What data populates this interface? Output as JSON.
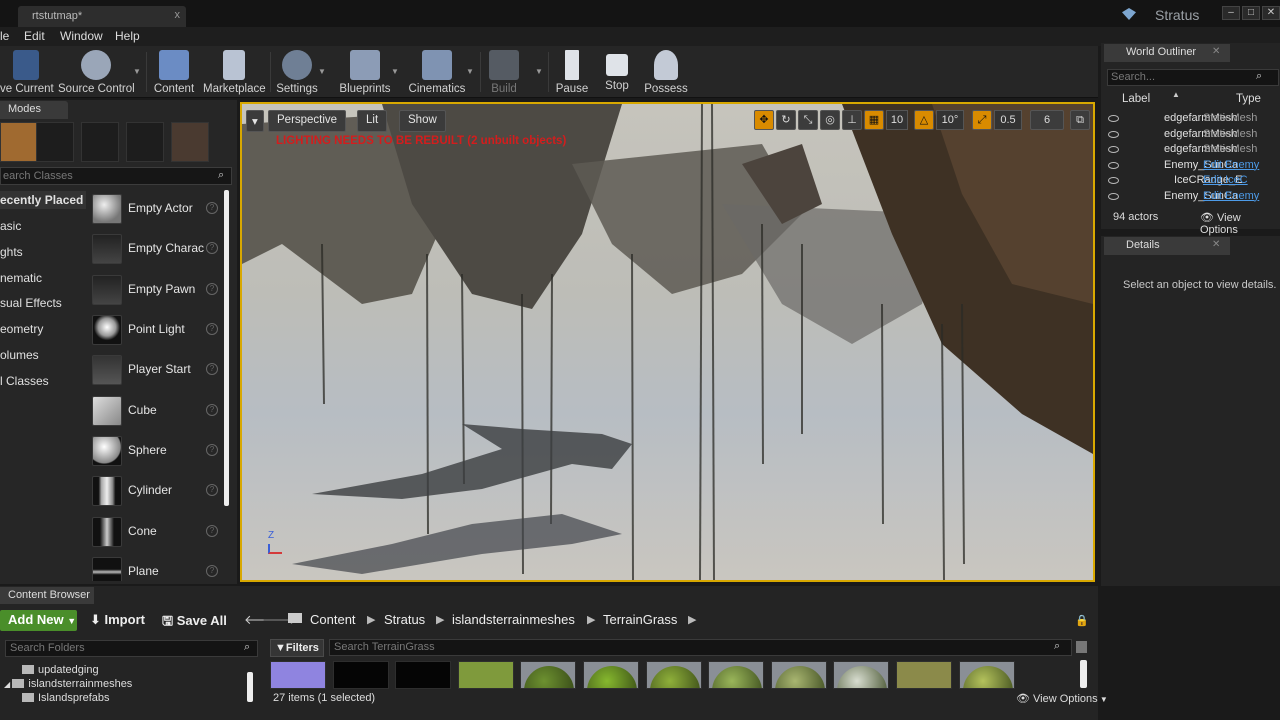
{
  "window": {
    "tab_title": "rtstutmap*",
    "project": "Stratus",
    "tab_close": "x",
    "controls": [
      "–",
      "□",
      "✕"
    ]
  },
  "menu": [
    "le",
    "Edit",
    "Window",
    "Help"
  ],
  "toolbar": [
    {
      "label": "ve Current",
      "icon": "save-icon"
    },
    {
      "label": "Source Control",
      "icon": "source-control-icon"
    },
    {
      "label": "Content",
      "icon": "content-icon"
    },
    {
      "label": "Marketplace",
      "icon": "marketplace-icon"
    },
    {
      "label": "Settings",
      "icon": "settings-icon"
    },
    {
      "label": "Blueprints",
      "icon": "blueprints-icon"
    },
    {
      "label": "Cinematics",
      "icon": "cinematics-icon"
    },
    {
      "label": "Build",
      "icon": "build-icon"
    },
    {
      "label": "Pause",
      "icon": "pause-icon"
    },
    {
      "label": "Stop",
      "icon": "stop-icon"
    },
    {
      "label": "Possess",
      "icon": "possess-icon"
    }
  ],
  "modes": {
    "tab": "Modes",
    "search_placeholder": "earch Classes",
    "categories": [
      "ecently Placed",
      "asic",
      "ghts",
      "nematic",
      "sual Effects",
      "eometry",
      "olumes",
      "l Classes"
    ],
    "selected_category": 0,
    "items": [
      "Empty Actor",
      "Empty Charac",
      "Empty Pawn",
      "Point Light",
      "Player Start",
      "Cube",
      "Sphere",
      "Cylinder",
      "Cone",
      "Plane"
    ],
    "help_glyph": "?"
  },
  "viewport": {
    "perspective": "Perspective",
    "lit": "Lit",
    "show": "Show",
    "warning": "LIGHTING NEEDS TO BE REBUILT (2 unbuilt objects)",
    "grid_snap": "10",
    "rot_snap": "10°",
    "scale_snap": "0.5",
    "cam_speed": "6",
    "axis_label": "Z"
  },
  "outliner": {
    "tab": "World Outliner",
    "search_placeholder": "Search...",
    "col_label": "Label",
    "col_type": "Type",
    "rows": [
      {
        "name": "edgefarmMesh",
        "type": "StaticMesh",
        "link": false,
        "indent": 1
      },
      {
        "name": "edgefarmMesh",
        "type": "StaticMesh",
        "link": false,
        "indent": 1
      },
      {
        "name": "edgefarmMesh",
        "type": "StaticMesh",
        "link": false,
        "indent": 1
      },
      {
        "name": "Enemy_SunCa",
        "type": "Edit Enemy",
        "link": true,
        "indent": 0
      },
      {
        "name": "IceCRange_E",
        "type": "Edit IceC",
        "link": true,
        "indent": 2
      },
      {
        "name": "Enemy_SunCa",
        "type": "Edit Enemy",
        "link": true,
        "indent": 0
      }
    ],
    "actors": "94 actors",
    "view_options": "View Options"
  },
  "details": {
    "tab": "Details",
    "empty": "Select an object to view details."
  },
  "content_browser": {
    "tab": "Content Browser",
    "add_new": "Add New",
    "import": "Import",
    "save_all": "Save All",
    "path": [
      "Content",
      "Stratus",
      "islandsterrainmeshes",
      "TerrainGrass"
    ],
    "folder_search": "Search Folders",
    "folders": [
      "updatedging",
      "islandsterrainmeshes",
      "Islandsprefabs"
    ],
    "filters": "Filters",
    "asset_search": "Search TerrainGrass",
    "count": "27 items (1 selected)",
    "view_options": "View Options",
    "assets": [
      {
        "kind": "flat",
        "color": "#8f84e0"
      },
      {
        "kind": "flat",
        "color": "#050505"
      },
      {
        "kind": "flat",
        "color": "#050505"
      },
      {
        "kind": "flat",
        "color": "#7f9a3c"
      },
      {
        "kind": "sphere",
        "color": "#6d9130"
      },
      {
        "kind": "sphere",
        "color": "#86b82e"
      },
      {
        "kind": "sphere",
        "color": "#8fb03a"
      },
      {
        "kind": "sphere",
        "color": "#9ab65a"
      },
      {
        "kind": "sphere",
        "color": "#a9b671"
      },
      {
        "kind": "sphere",
        "color": "#d8ddd0"
      },
      {
        "kind": "flat",
        "color": "#8b8a4a"
      },
      {
        "kind": "sphere",
        "color": "#b4c25c"
      }
    ]
  }
}
